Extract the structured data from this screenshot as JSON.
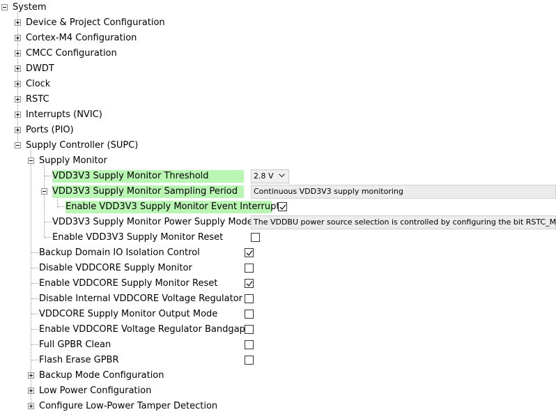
{
  "tree": {
    "root": {
      "label": "System",
      "expanded": true
    },
    "groups": [
      {
        "label": "Device & Project Configuration",
        "expanded": false
      },
      {
        "label": "Cortex-M4 Configuration",
        "expanded": false
      },
      {
        "label": "CMCC Configuration",
        "expanded": false
      },
      {
        "label": "DWDT",
        "expanded": false
      },
      {
        "label": "Clock",
        "expanded": false
      },
      {
        "label": "RSTC",
        "expanded": false
      },
      {
        "label": "Interrupts (NVIC)",
        "expanded": false
      },
      {
        "label": "Ports (PIO)",
        "expanded": false
      },
      {
        "label": "Supply Controller (SUPC)",
        "expanded": true
      }
    ],
    "supply_monitor": {
      "label": "Supply Monitor",
      "threshold": {
        "label": "VDD3V3 Supply Monitor Threshold",
        "value": "2.8 V"
      },
      "sampling": {
        "label": "VDD3V3 Supply Monitor Sampling Period",
        "value": "Continuous VDD3V3 supply monitoring"
      },
      "event_interrupt": {
        "label": "Enable VDD3V3 Supply Monitor Event Interrupt",
        "checked": true
      },
      "power_mode": {
        "label": "VDD3V3 Supply Monitor Power Supply Mode",
        "value": "The VDDBU power source selection is controlled by configuring the bit RSTC_MR.PWRSW."
      },
      "reset": {
        "label": "Enable VDD3V3 Supply Monitor Reset",
        "checked": false
      }
    },
    "options": [
      {
        "label": "Backup Domain IO Isolation Control",
        "checked": true
      },
      {
        "label": "Disable VDDCORE Supply Monitor",
        "checked": false
      },
      {
        "label": "Enable VDDCORE Supply Monitor Reset",
        "checked": true
      },
      {
        "label": "Disable Internal VDDCORE Voltage Regulator",
        "checked": false
      },
      {
        "label": "VDDCORE Supply Monitor Output Mode",
        "checked": false
      },
      {
        "label": "Enable VDDCORE Voltage Regulator Bandgap",
        "checked": false
      },
      {
        "label": "Full GPBR Clean",
        "checked": false
      },
      {
        "label": "Flash Erase GPBR",
        "checked": false
      }
    ],
    "sub_groups": [
      {
        "label": "Backup Mode Configuration",
        "expanded": false
      },
      {
        "label": "Low Power Configuration",
        "expanded": false
      },
      {
        "label": "Configure Low-Power Tamper Detection",
        "expanded": false
      }
    ]
  }
}
